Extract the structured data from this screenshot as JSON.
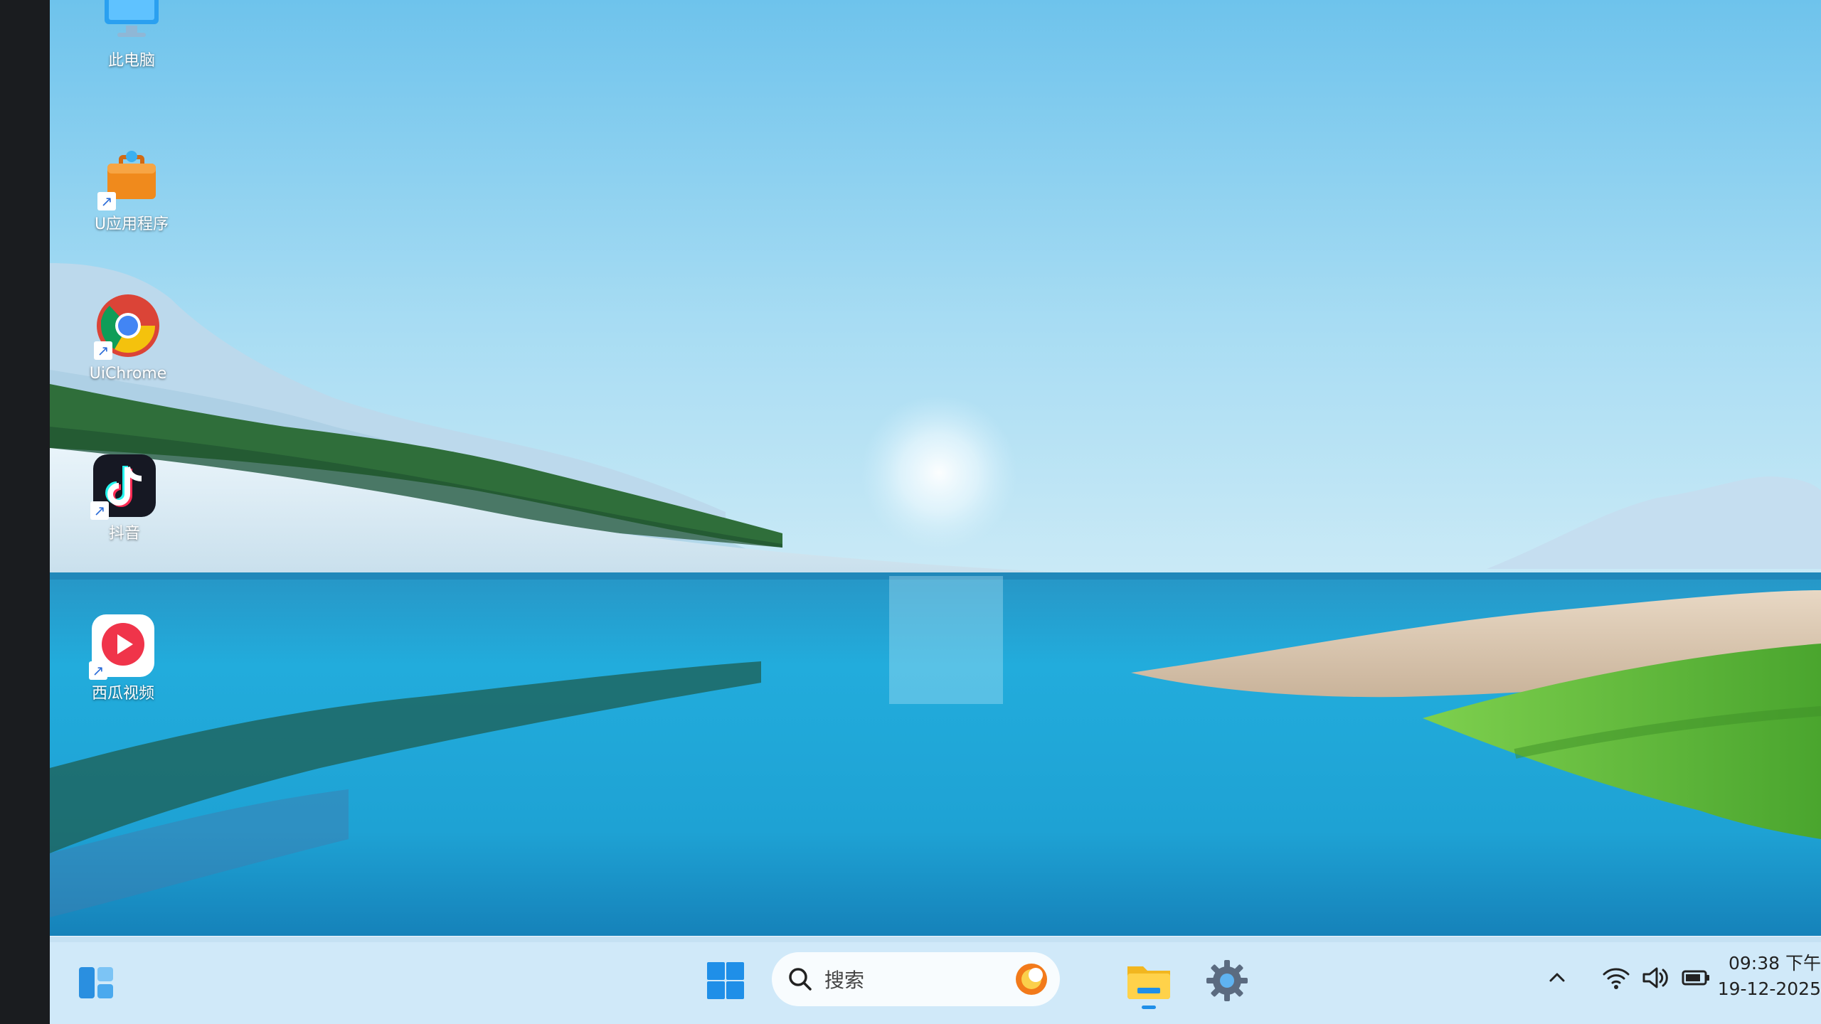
{
  "desktop": {
    "icons": [
      {
        "name": "this-pc",
        "label": "此电脑"
      },
      {
        "name": "uni-apps",
        "label": "U应用程序"
      },
      {
        "name": "uichrome",
        "label": "UiChrome"
      },
      {
        "name": "douyin",
        "label": "抖音"
      },
      {
        "name": "xigua",
        "label": "西瓜视频"
      }
    ]
  },
  "taskbar": {
    "search_placeholder": "搜索",
    "time": "09:38 下午",
    "date": "19-12-2025",
    "icons": [
      "widgets-icon",
      "windows-start-icon",
      "search-icon",
      "copilot-icon",
      "file-explorer-icon",
      "settings-gear-icon",
      "chevron-up-icon",
      "wifi-icon",
      "volume-icon",
      "battery-icon"
    ]
  },
  "colors": {
    "sky_top": "#7cc7ee",
    "lake": "#1aa8d8",
    "grass": "#57b83a",
    "start_blue": "#1f8fe8"
  }
}
